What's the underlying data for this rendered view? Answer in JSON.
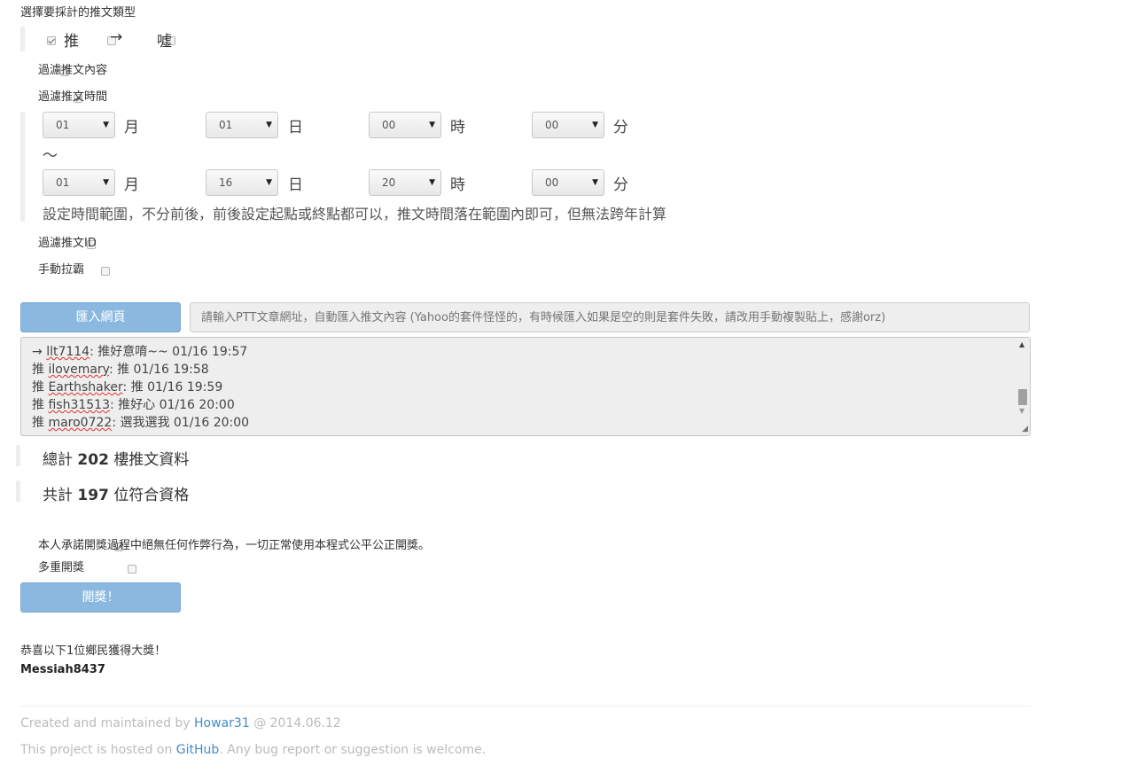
{
  "type_section": {
    "heading": "選擇要採計的推文類型",
    "push_label": "推",
    "arrow_label": "→",
    "boo_label": "噓",
    "push_checked": true,
    "arrow_checked": false,
    "boo_checked": false
  },
  "filter_content_label": "過濾推文內容",
  "filter_time_label": "過濾推文時間",
  "time_range": {
    "from": {
      "month": "01",
      "day": "01",
      "hour": "00",
      "minute": "00"
    },
    "to": {
      "month": "01",
      "day": "16",
      "hour": "20",
      "minute": "00"
    },
    "unit_month": "月",
    "unit_day": "日",
    "unit_hour": "時",
    "unit_minute": "分",
    "tilde": "～",
    "hint": "設定時間範圍，不分前後，前後設定起點或終點都可以，推文時間落在範圍內即可，但無法跨年計算"
  },
  "filter_id_label": "過濾推文ID",
  "manual_label": "手動拉霸",
  "import": {
    "button_label": "匯入網頁",
    "placeholder": "請輸入PTT文章網址，自動匯入推文內容 (Yahoo的套件怪怪的，有時候匯入如果是空的則是套件失敗，請改用手動複製貼上，感謝orz)"
  },
  "comments": [
    {
      "tag": "→",
      "id": "llt7114",
      "text": ": 推好意唷~~ 01/16 19:57"
    },
    {
      "tag": "推",
      "id": "ilovemary",
      "text": ": 推 01/16 19:58"
    },
    {
      "tag": "推",
      "id": "Earthshaker",
      "text": ": 推 01/16 19:59"
    },
    {
      "tag": "推",
      "id": "fish31513",
      "text": ": 推好心 01/16 20:00"
    },
    {
      "tag": "推",
      "id": "maro0722",
      "text": ": 選我選我 01/16 20:00"
    }
  ],
  "stats": {
    "total_prefix": "總計",
    "total_count": "202",
    "total_suffix": "樓推文資料",
    "eligible_prefix": "共計",
    "eligible_count": "197",
    "eligible_suffix": "位符合資格"
  },
  "pledge_label": "本人承諾開獎過程中絕無任何作弊行為，一切正常使用本程式公平公正開獎。",
  "multi_draw_label": "多重開獎",
  "draw_button_label": "開獎！",
  "result": {
    "congrats": "恭喜以下1位鄉民獲得大獎！",
    "winner": "Messiah8437"
  },
  "footer": {
    "created_prefix": "Created and maintained by",
    "author": "Howar31",
    "created_suffix": "@ 2014.06.12",
    "hosted_prefix": "This project is hosted on",
    "github": "GitHub",
    "hosted_suffix": ". Any bug report or suggestion is welcome."
  }
}
